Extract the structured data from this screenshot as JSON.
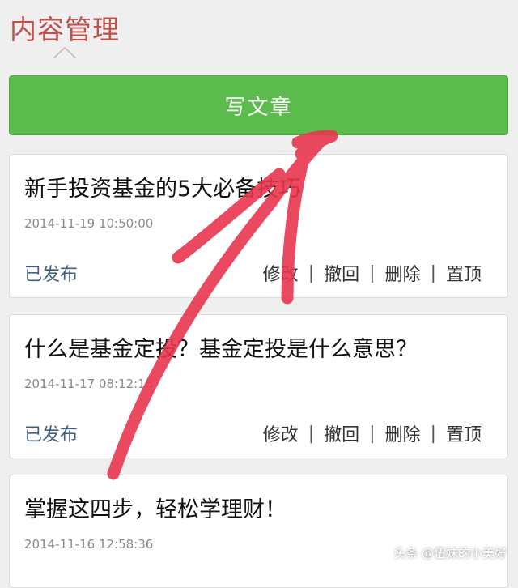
{
  "header": {
    "title": "内容管理"
  },
  "write_button": {
    "label": "写文章"
  },
  "articles": [
    {
      "title": "新手投资基金的5大必备技巧",
      "date": "2014-11-19 10:50:00",
      "status": "已发布",
      "actions": [
        "修改",
        "撤回",
        "删除",
        "置顶"
      ]
    },
    {
      "title": "什么是基金定投？基金定投是什么意思？",
      "date": "2014-11-17 08:12:16",
      "status": "已发布",
      "actions": [
        "修改",
        "撤回",
        "删除",
        "置顶"
      ]
    },
    {
      "title": "掌握这四步，轻松学理财！",
      "date": "2014-11-16 12:58:36"
    }
  ],
  "watermark": "头条 @伍妹的小美好",
  "colors": {
    "title": "#c0504a",
    "button": "#5bbb4c",
    "annotation": "#e8364f",
    "status": "#41607e"
  },
  "icons": {
    "caret": "chevron-up-icon"
  }
}
